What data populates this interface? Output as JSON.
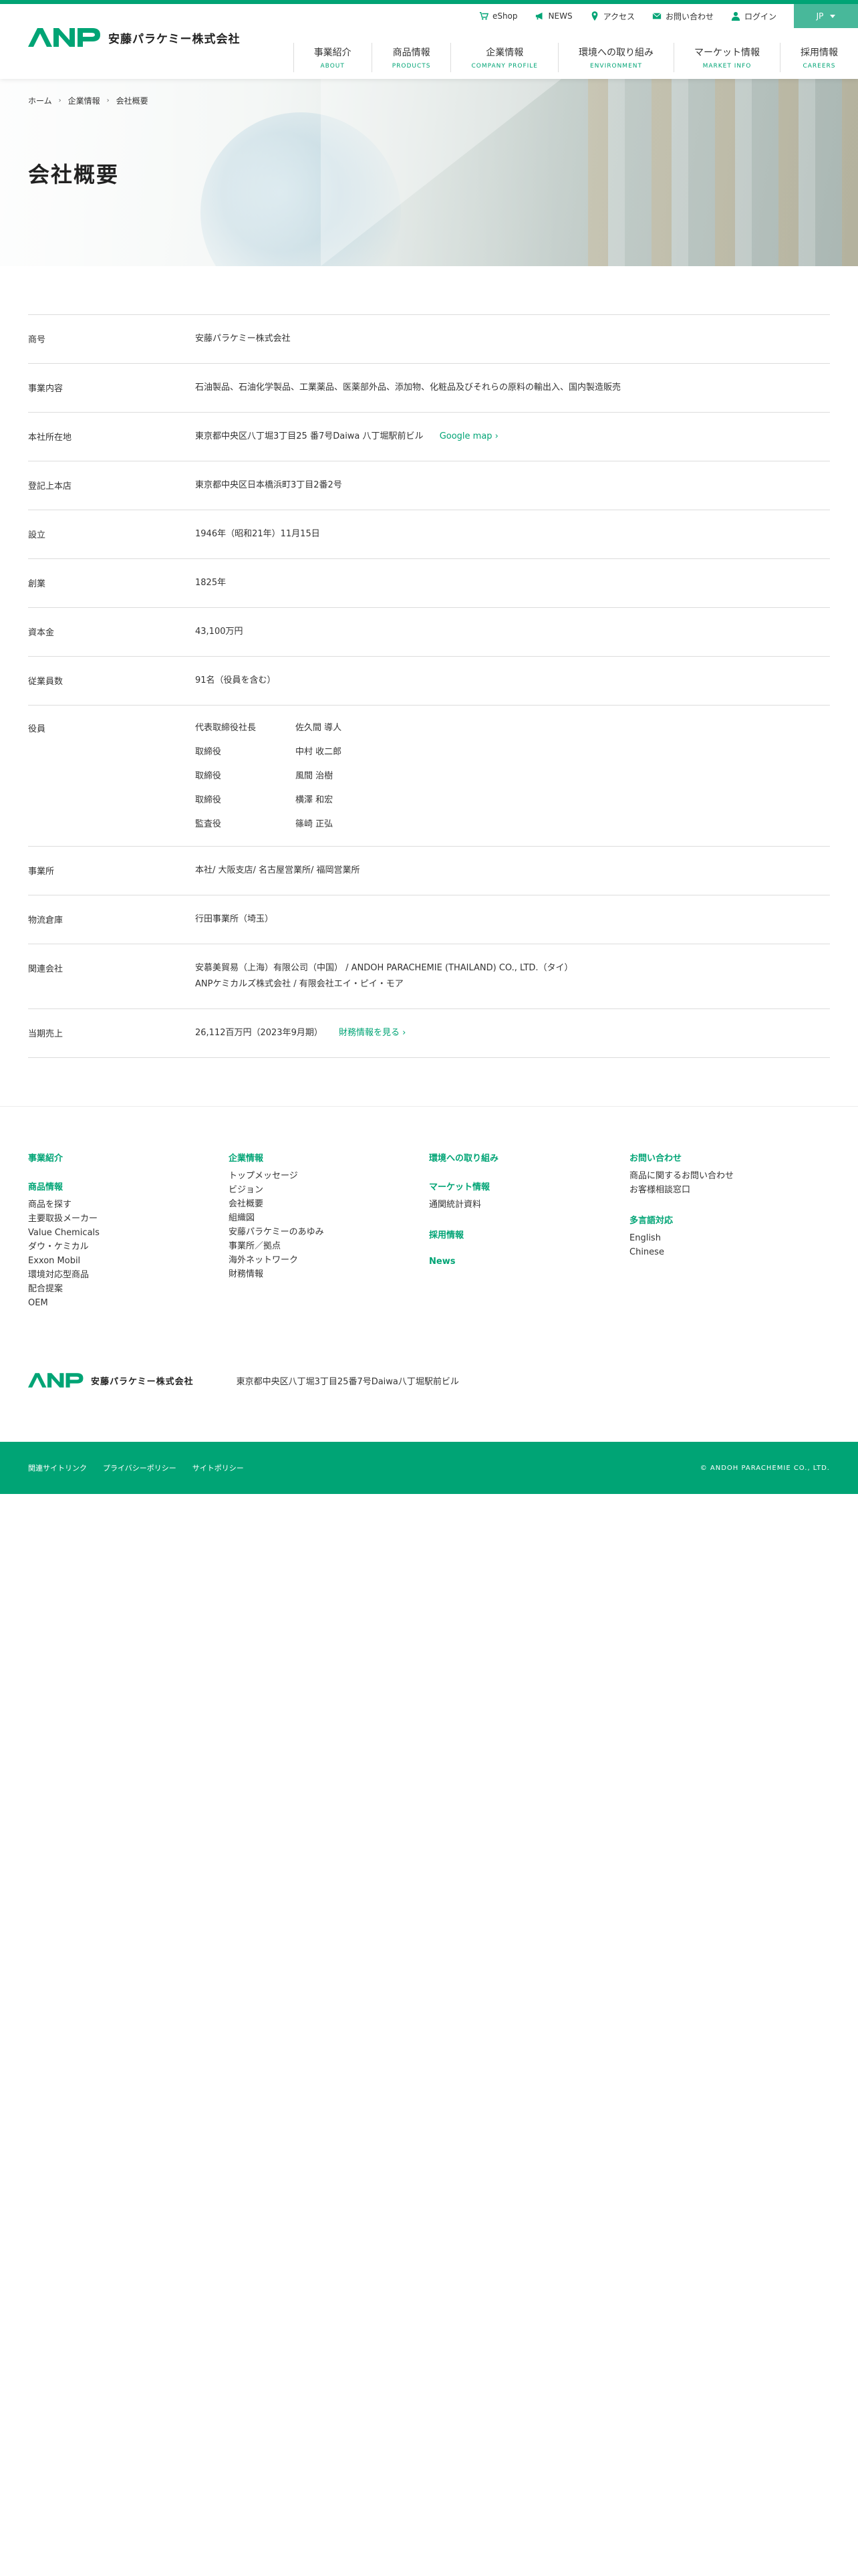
{
  "brand": {
    "logo_mark": "ANP",
    "company_name": "安藤パラケミー株式会社",
    "accent": "#00a475"
  },
  "utility": [
    {
      "label": "eShop",
      "icon": "cart-icon"
    },
    {
      "label": "NEWS",
      "icon": "megaphone-icon"
    },
    {
      "label": "アクセス",
      "icon": "map-pin-icon"
    },
    {
      "label": "お問い合わせ",
      "icon": "mail-icon"
    },
    {
      "label": "ログイン",
      "icon": "user-icon"
    }
  ],
  "language": {
    "selected": "JP"
  },
  "nav": [
    {
      "jp": "事業紹介",
      "en": "ABOUT"
    },
    {
      "jp": "商品情報",
      "en": "PRODUCTS"
    },
    {
      "jp": "企業情報",
      "en": "COMPANY PROFILE"
    },
    {
      "jp": "環境への取り組み",
      "en": "ENVIRONMENT"
    },
    {
      "jp": "マーケット情報",
      "en": "MARKET INFO"
    },
    {
      "jp": "採用情報",
      "en": "CAREERS"
    }
  ],
  "breadcrumb": [
    "ホーム",
    "企業情報",
    "会社概要"
  ],
  "page_title": "会社概要",
  "profile": {
    "trade_name": {
      "label": "商号",
      "value": "安藤パラケミー株式会社"
    },
    "business": {
      "label": "事業内容",
      "value": "石油製品、石油化学製品、工業薬品、医薬部外品、添加物、化粧品及びそれらの原料の輸出入、国内製造販売"
    },
    "head_office": {
      "label": "本社所在地",
      "value": "東京都中央区八丁堀3丁目25 番7号Daiwa 八丁堀駅前ビル",
      "link": "Google map"
    },
    "registered_office": {
      "label": "登記上本店",
      "value": "東京都中央区日本橋浜町3丁目2番2号"
    },
    "established": {
      "label": "設立",
      "value": "1946年（昭和21年）11月15日"
    },
    "founded": {
      "label": "創業",
      "value": "1825年"
    },
    "capital": {
      "label": "資本金",
      "value": "43,100万円"
    },
    "employees": {
      "label": "従業員数",
      "value": "91名（役員を含む）"
    },
    "officers": {
      "label": "役員",
      "list": [
        {
          "title": "代表取締役社長",
          "name": "佐久間 導人"
        },
        {
          "title": "取締役",
          "name": "中村 收二郎"
        },
        {
          "title": "取締役",
          "name": "風間 治樹"
        },
        {
          "title": "取締役",
          "name": "横澤 和宏"
        },
        {
          "title": "監査役",
          "name": "篠崎 正弘"
        }
      ]
    },
    "offices": {
      "label": "事業所",
      "value": "本社/ 大阪支店/ 名古屋営業所/ 福岡営業所"
    },
    "warehouse": {
      "label": "物流倉庫",
      "value": "行田事業所（埼玉）"
    },
    "affiliates": {
      "label": "関連会社",
      "line1": "安慕美貿易（上海）有限公司（中国） / ANDOH PARACHEMIE (THAILAND) CO., LTD.（タイ）",
      "line2": "ANPケミカルズ株式会社 / 有限会社エイ・ピイ・モア"
    },
    "sales": {
      "label": "当期売上",
      "value": "26,112百万円（2023年9月期）",
      "link": "財務情報を見る"
    }
  },
  "footer": {
    "col1": {
      "head1": "事業紹介",
      "head2": "商品情報",
      "links": [
        "商品を探す",
        "主要取扱メーカー",
        "Value Chemicals",
        "ダウ・ケミカル",
        "Exxon Mobil",
        "環境対応型商品",
        "配合提案",
        "OEM"
      ]
    },
    "col2": {
      "head": "企業情報",
      "links": [
        "トップメッセージ",
        "ビジョン",
        "会社概要",
        "組織図",
        "安藤パラケミーのあゆみ",
        "事業所／拠点",
        "海外ネットワーク",
        "財務情報"
      ]
    },
    "col3": {
      "head1": "環境への取り組み",
      "head2": "マーケット情報",
      "link2": "通関統計資料",
      "head3": "採用情報",
      "head4": "News"
    },
    "col4": {
      "head1": "お問い合わせ",
      "links1": [
        "商品に関するお問い合わせ",
        "お客様相談窓口"
      ],
      "head2": "多言語対応",
      "links2": [
        "English",
        "Chinese"
      ]
    },
    "address": "東京都中央区八丁堀3丁目25番7号Daiwa八丁堀駅前ビル",
    "bar_links": [
      "関連サイトリンク",
      "プライバシーポリシー",
      "サイトポリシー"
    ],
    "copyright": "© ANDOH PARACHEMIE CO., LTD."
  }
}
